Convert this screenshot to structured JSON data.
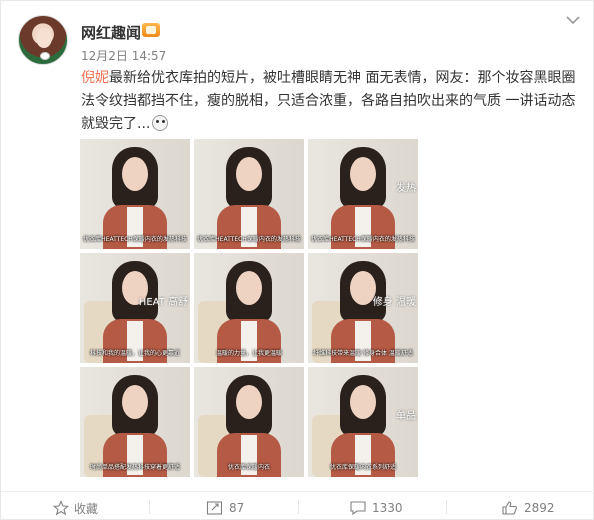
{
  "post": {
    "user_name": "网红趣闻",
    "time": "12月2日 14:57",
    "mention": "倪妮",
    "text_line1_rest": "最新给优衣库拍的短片，被吐槽眼睛无神 面无表情，网友：那个妆容黑眼圈",
    "text_line2": "法令纹挡都挡不住，瘦的脱相，只适合浓重，各路自拍吹出来的气质 一讲话动态",
    "text_line3": "就毁完了..."
  },
  "images": [
    {
      "caption": "优衣库HEATTECH保暖内衣的发热科技",
      "overlay": ""
    },
    {
      "caption": "优衣库HEATTECH保暖内衣的发热科技",
      "overlay": ""
    },
    {
      "caption": "优衣库HEATTECH保暖内衣的发热科技",
      "overlay": "发热"
    },
    {
      "caption": "科技和我的温暖，让我的心更靠近",
      "overlay": "HEAT 高舒"
    },
    {
      "caption": "温暖的力量，让我更温暖",
      "overlay": ""
    },
    {
      "caption": "纤维科技带来温暖 修身合体 温暖舒适",
      "overlay": "修身 温暖"
    },
    {
      "caption": "时尚单品搭配发热科技穿着更舒适",
      "overlay": ""
    },
    {
      "caption": "优衣库保暖内衣",
      "overlay": ""
    },
    {
      "caption": "优衣库保暖内衣系列舒适",
      "overlay": "单品"
    }
  ],
  "footer": {
    "favorite_label": "收藏",
    "repost_count": "87",
    "comment_count": "1330",
    "like_count": "2892"
  },
  "icons": {
    "more": "chevron-down-icon",
    "favorite": "star-icon",
    "repost": "repost-icon",
    "comment": "comment-icon",
    "like": "thumbs-up-icon"
  },
  "colors": {
    "mention": "#eb7350",
    "muted": "#808080"
  }
}
